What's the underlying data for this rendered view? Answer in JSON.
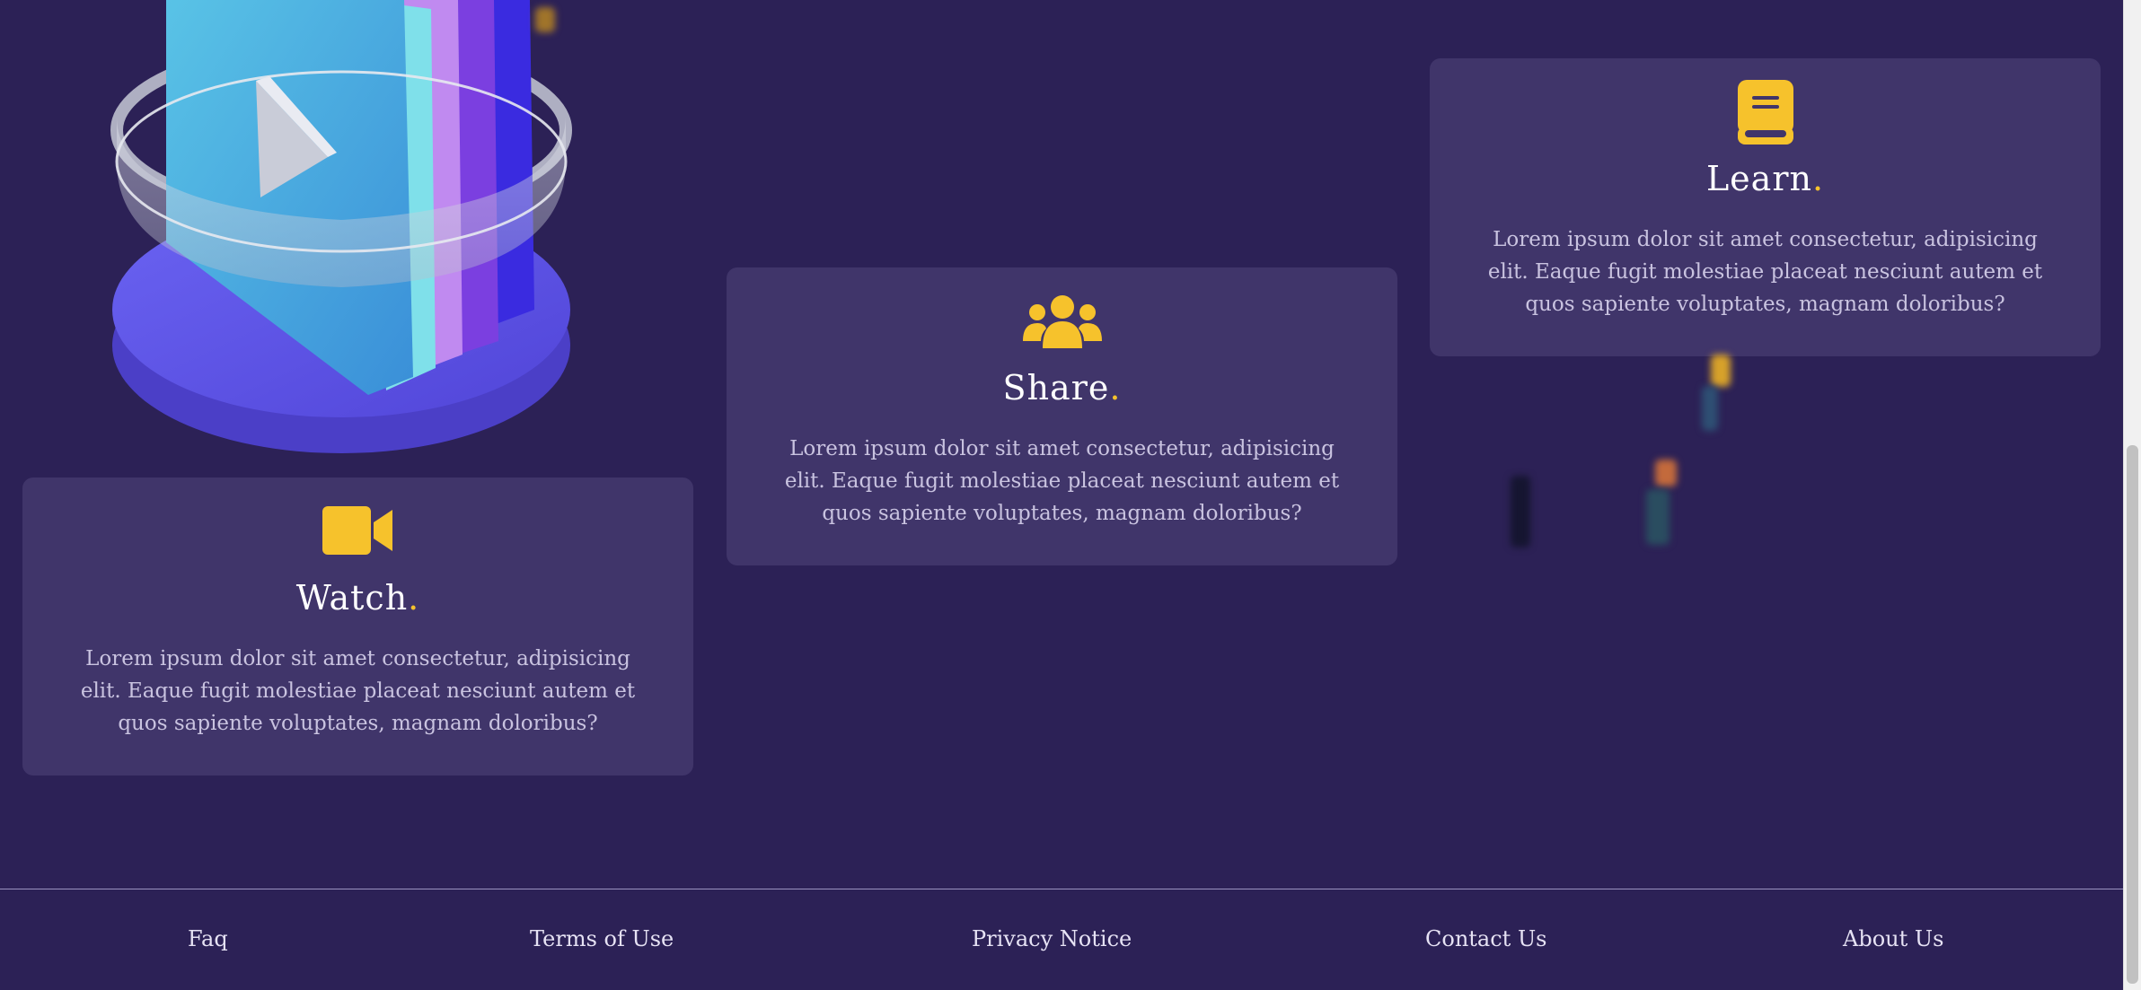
{
  "cards": {
    "learn": {
      "title": "Learn",
      "dot": ".",
      "icon": "book-icon",
      "text": "Lorem ipsum dolor sit amet consectetur, adipisicing elit. Eaque fugit molestiae placeat nesciunt autem et quos sapiente voluptates, magnam doloribus?"
    },
    "share": {
      "title": "Share",
      "dot": ".",
      "icon": "users-icon",
      "text": "Lorem ipsum dolor sit amet consectetur, adipisicing elit. Eaque fugit molestiae placeat nesciunt autem et quos sapiente voluptates, magnam doloribus?"
    },
    "watch": {
      "title": "Watch",
      "dot": ".",
      "icon": "video-camera-icon",
      "text": "Lorem ipsum dolor sit amet consectetur, adipisicing elit. Eaque fugit molestiae placeat nesciunt autem et quos sapiente voluptates, magnam doloribus?"
    }
  },
  "footer": {
    "links": [
      "Faq",
      "Terms of Use",
      "Privacy Notice",
      "Contact Us",
      "About Us"
    ]
  },
  "colors": {
    "background": "#2c2156",
    "card": "#40356a",
    "accent": "#f6c22c"
  }
}
